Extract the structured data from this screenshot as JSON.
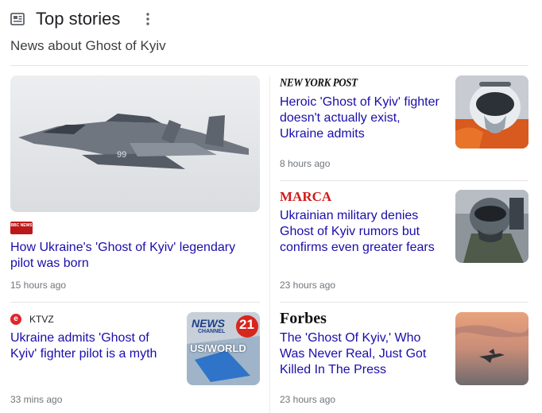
{
  "header": {
    "title": "Top stories",
    "subtitle": "News about Ghost of Kyiv"
  },
  "stories": [
    {
      "source": "BBC NEWS",
      "headline": "How Ukraine's 'Ghost of Kyiv' legendary pilot was born",
      "time": "15 hours ago",
      "image_caption": "99"
    },
    {
      "source": "NEW YORK POST",
      "headline": "Heroic 'Ghost of Kyiv' fighter doesn't actually exist, Ukraine admits",
      "time": "8 hours ago"
    },
    {
      "source": "MARCA",
      "headline": "Ukrainian military denies Ghost of Kyiv rumors but confirms even greater fears",
      "time": "23 hours ago"
    },
    {
      "source": "KTVZ",
      "headline": "Ukraine admits 'Ghost of Kyiv' fighter pilot is a myth",
      "time": "33 mins ago",
      "thumb_line1": "NEWS",
      "thumb_line2": "CHANNEL",
      "thumb_num": "21",
      "thumb_line3": "US/WORLD"
    },
    {
      "source": "Forbes",
      "headline": "The 'Ghost Of Kyiv,' Who Was Never Real, Just Got Killed In The Press",
      "time": "23 hours ago"
    }
  ]
}
